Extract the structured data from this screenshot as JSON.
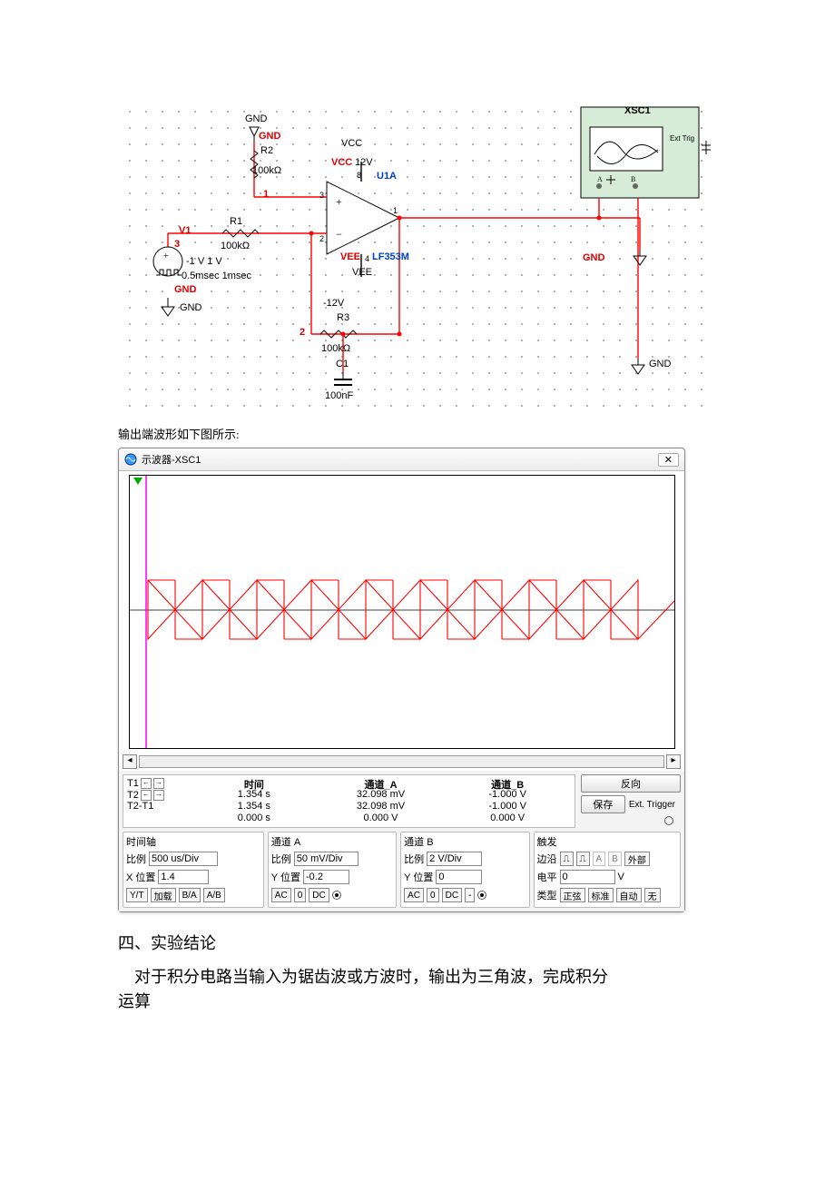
{
  "circuit": {
    "gnd_top": "GND",
    "gnd_top_red": "GND",
    "r2_name": "R2",
    "r2_val": "100kΩ",
    "net1": "1",
    "vcc": "VCC",
    "vcc_red": "VCC",
    "v12": "12V",
    "ref": "U1A",
    "pin8": "8",
    "pin3": "3",
    "pin2": "2",
    "pin4": "4",
    "pin1": "1",
    "v1": "V1",
    "r1_name": "R1",
    "r1_val": "100kΩ",
    "v1_amp": "-1 V 1 V",
    "v1_time": "0.5msec 1msec",
    "net3": "3",
    "gnd_left_red": "GND",
    "gnd_left": "GND",
    "vee": "VEE",
    "vee_red": "VEE",
    "part": "LF353M",
    "n12": "-12V",
    "r3_name": "R3",
    "r3_val": "100kΩ",
    "net2": "2",
    "c1_name": "C1",
    "c1_val": "100nF",
    "xsc1": "XSC1",
    "ext": "Ext Trig",
    "a": "A",
    "b": "B",
    "gnd_right": "GND",
    "gnd_osc": "GND"
  },
  "caption": "输出端波形如下图所示:",
  "scope": {
    "title": "示波器-XSC1",
    "close": "✕",
    "readout": {
      "t1_label": "T1",
      "t2_label": "T2",
      "diff_label": "T2-T1",
      "time_h": "时间",
      "cha_h": "通道_A",
      "chb_h": "通道_B",
      "t1_time": "1.354 s",
      "t2_time": "1.354 s",
      "diff_time": "0.000 s",
      "t1_a": "32.098 mV",
      "t2_a": "32.098 mV",
      "diff_a": "0.000 V",
      "t1_b": "-1.000 V",
      "t2_b": "-1.000 V",
      "diff_b": "0.000 V",
      "reverse": "反向",
      "save": "保存",
      "ext": "Ext. Trigger"
    },
    "time_g": {
      "title": "时间轴",
      "scale_l": "比例",
      "scale_v": "500 us/Div",
      "xpos_l": "X 位置",
      "xpos_v": "1.4",
      "yt": "Y/T",
      "add": "加载",
      "ba": "B/A",
      "ab": "A/B"
    },
    "cha_g": {
      "title": "通道 A",
      "scale_l": "比例",
      "scale_v": "50 mV/Div",
      "ypos_l": "Y 位置",
      "ypos_v": "-0.2",
      "ac": "AC",
      "zero": "0",
      "dc": "DC"
    },
    "chb_g": {
      "title": "通道 B",
      "scale_l": "比例",
      "scale_v": "2 V/Div",
      "ypos_l": "Y 位置",
      "ypos_v": "0",
      "ac": "AC",
      "zero": "0",
      "dc": "DC",
      "minus": "-"
    },
    "trig_g": {
      "title": "触发",
      "edge_l": "边沿",
      "a": "A",
      "b": "B",
      "ext": "外部",
      "level_l": "电平",
      "level_v": "0",
      "level_u": "V",
      "type_l": "类型",
      "sine": "正弦",
      "norm": "标准",
      "auto": "自动",
      "none": "无"
    }
  },
  "chart_data": {
    "type": "line",
    "title": "",
    "notes": "Oscilloscope trace: magenta channel A near baseline; red channel B combines a square wave and its integrated triangle wave",
    "x_unit": "div",
    "x_range_div": [
      0,
      12
    ],
    "channels": [
      {
        "name": "A",
        "color": "#f0f",
        "scale": "50 mV/Div",
        "y_offset_div": -0.2,
        "approx_level_mV": 32
      },
      {
        "name": "B",
        "color": "#f00",
        "scale": "2 V/Div",
        "y_offset_div": 0,
        "square": {
          "low_V": -1,
          "high_V": 1,
          "period_div": 2.4,
          "duty": 0.5
        },
        "triangle": {
          "min_V": -1,
          "max_V": 1,
          "period_div": 2.4
        }
      }
    ]
  },
  "conclusion": {
    "heading": "四、实验结论",
    "line1": "对于积分电路当输入为锯齿波或方波时，输出为三角波，完成积分",
    "line2": "运算"
  }
}
